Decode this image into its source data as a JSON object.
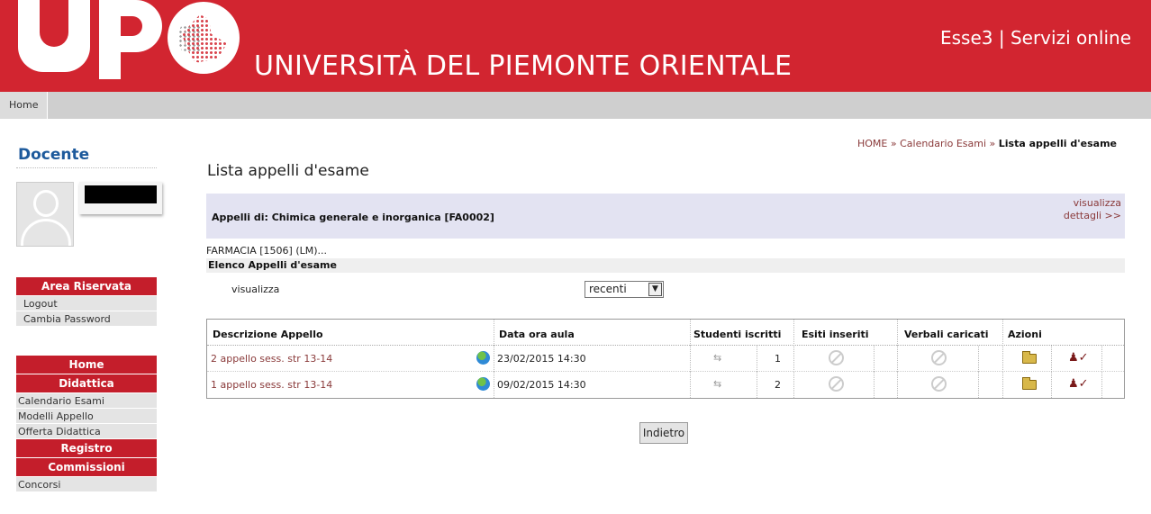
{
  "header": {
    "university_name": "UNIVERSITÀ DEL PIEMONTE ORIENTALE",
    "service_title": "Esse3 | Servizi online",
    "brand_color": "#d22530"
  },
  "navbar": {
    "home_label": "Home"
  },
  "sidebar": {
    "role_title": "Docente",
    "area_riservata": {
      "title": "Area Riservata",
      "items": [
        "Logout",
        "Cambia Password"
      ]
    },
    "sections": [
      {
        "title": "Home"
      },
      {
        "title": "Didattica",
        "items": [
          "Calendario Esami",
          "Modelli Appello",
          "Offerta Didattica"
        ]
      },
      {
        "title": "Registro"
      },
      {
        "title": "Commissioni",
        "items": [
          "Concorsi"
        ]
      }
    ]
  },
  "breadcrumb": {
    "home": "HOME",
    "calendar": "Calendario Esami",
    "current": "Lista appelli d'esame",
    "separator": "»"
  },
  "main": {
    "page_title": "Lista appelli d'esame",
    "appelli_label": "Appelli di: Chimica generale e inorganica [FA0002]",
    "visualizza_dettagli": "visualizza dettagli >>",
    "course": "FARMACIA [1506] (LM)...",
    "elenco_title": "Elenco Appelli d'esame",
    "filter_label": "visualizza",
    "filter_value": "recenti",
    "back_button": "Indietro"
  },
  "table": {
    "headers": [
      "Descrizione Appello",
      "Data ora aula",
      "Studenti iscritti",
      "Esiti inseriti",
      "Verbali caricati",
      "Azioni"
    ],
    "rows": [
      {
        "description": "2 appello sess. str 13-14",
        "datetime": "23/02/2015 14:30",
        "enrolled": "1"
      },
      {
        "description": "1 appello sess. str 13-14",
        "datetime": "09/02/2015 14:30",
        "enrolled": "2"
      }
    ]
  }
}
